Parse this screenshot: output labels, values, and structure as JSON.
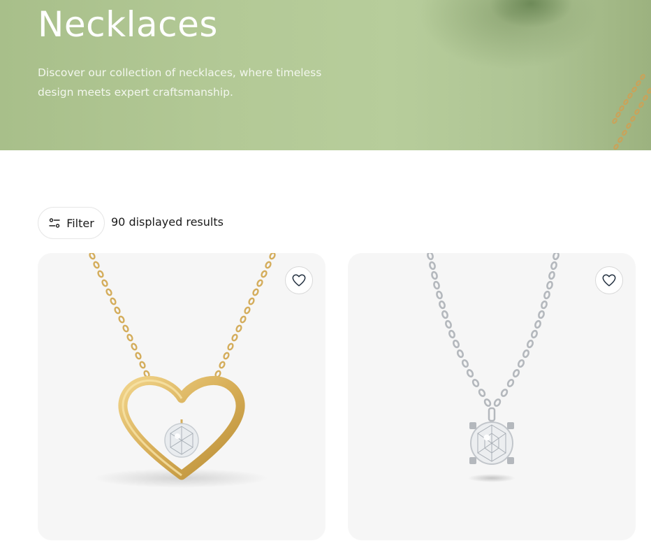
{
  "hero": {
    "title": "Necklaces",
    "description": "Discover our collection of necklaces, where timeless design meets expert craftsmanship."
  },
  "toolbar": {
    "filter_label": "Filter",
    "results_text": "90 displayed results"
  },
  "products": [
    {
      "image_icon": "gold-heart-necklace-image",
      "wishlist_icon": "heart-outline-icon"
    },
    {
      "image_icon": "silver-solitaire-necklace-image",
      "wishlist_icon": "heart-outline-icon"
    }
  ],
  "colors": {
    "hero_background": "#b3c996",
    "card_background": "#f6f6f6",
    "text": "#1a1a1a",
    "wishlist_icon": "#1f2d3d",
    "gold": "#d9b35e",
    "silver": "#b9bcc0"
  }
}
